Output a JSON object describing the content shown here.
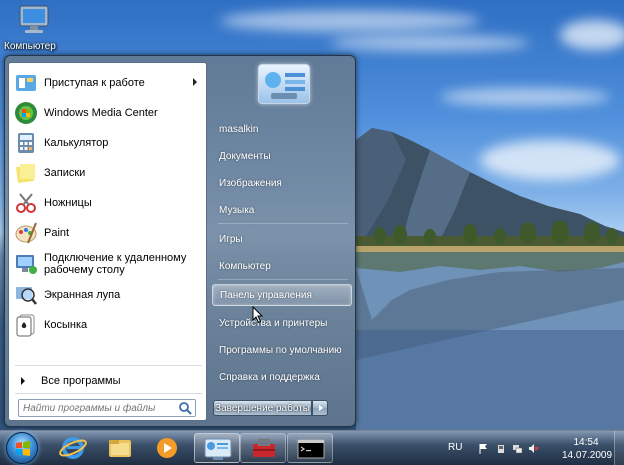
{
  "desktop": {
    "icons": [
      {
        "label": "Компьютер",
        "icon": "computer-icon"
      }
    ]
  },
  "start_menu": {
    "programs": [
      {
        "label": "Приступая к работе",
        "icon": "getting-started-icon",
        "has_submenu": true
      },
      {
        "label": "Windows Media Center",
        "icon": "media-center-icon"
      },
      {
        "label": "Калькулятор",
        "icon": "calculator-icon"
      },
      {
        "label": "Записки",
        "icon": "sticky-notes-icon"
      },
      {
        "label": "Ножницы",
        "icon": "snipping-tool-icon"
      },
      {
        "label": "Paint",
        "icon": "paint-icon"
      },
      {
        "label": "Подключение к удаленному рабочему столу",
        "icon": "remote-desktop-icon"
      },
      {
        "label": "Экранная лупа",
        "icon": "magnifier-icon"
      },
      {
        "label": "Косынка",
        "icon": "solitaire-icon"
      }
    ],
    "all_programs": "Все программы",
    "search_placeholder": "Найти программы и файлы",
    "right_items": [
      {
        "label": "masalkin"
      },
      {
        "label": "Документы"
      },
      {
        "label": "Изображения"
      },
      {
        "label": "Музыка"
      },
      {
        "label": "Игры"
      },
      {
        "label": "Компьютер"
      },
      {
        "label": "Панель управления",
        "highlighted": true
      },
      {
        "label": "Устройства и принтеры"
      },
      {
        "label": "Программы по умолчанию"
      },
      {
        "label": "Справка и поддержка"
      }
    ],
    "shutdown_label": "Завершение работы"
  },
  "taskbar": {
    "pinned": [
      "internet-explorer-icon",
      "explorer-icon",
      "media-player-icon",
      "control-panel-icon",
      "toolbox-icon",
      "cmd-icon"
    ],
    "language": "RU",
    "time": "14:54",
    "date": "14.07.2009"
  }
}
